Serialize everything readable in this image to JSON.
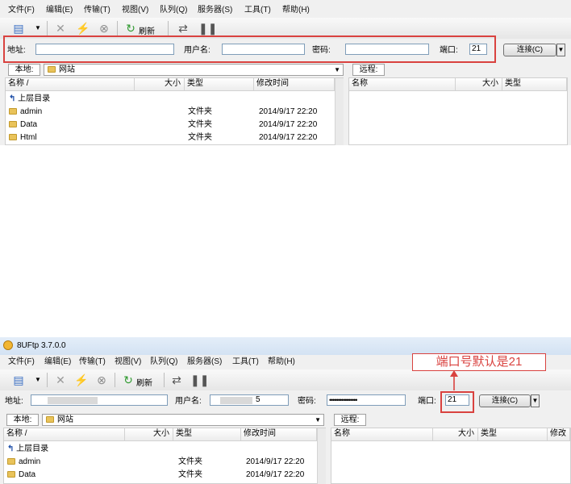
{
  "top": {
    "menu": [
      "文件(F)",
      "编辑(E)",
      "传输(T)",
      "视图(V)",
      "队列(Q)",
      "服务器(S)",
      "工具(T)",
      "帮助(H)"
    ],
    "toolbar": {
      "refresh_label": "刷新"
    },
    "quickconnect": {
      "host_label": "地址:",
      "host_value": "",
      "user_label": "用户名:",
      "user_value": "",
      "password_label": "密码:",
      "password_value": "",
      "port_label": "端口:",
      "port_value": "21",
      "connect_label": "连接(C)"
    },
    "local": {
      "tab_label": "本地:",
      "path": "网站",
      "columns": [
        "名称 /",
        "大小",
        "类型",
        "修改时间"
      ],
      "parent_label": "上层目录",
      "rows": [
        {
          "name": "admin",
          "type": "文件夹",
          "modified": "2014/9/17 22:20"
        },
        {
          "name": "Data",
          "type": "文件夹",
          "modified": "2014/9/17 22:20"
        },
        {
          "name": "Html",
          "type": "文件夹",
          "modified": "2014/9/17 22:20"
        }
      ]
    },
    "remote": {
      "tab_label": "远程:",
      "columns": [
        "名称",
        "大小",
        "类型"
      ]
    }
  },
  "bottom": {
    "app_title": "8UFtp 3.7.0.0",
    "menu": [
      "文件(F)",
      "编辑(E)",
      "传输(T)",
      "视图(V)",
      "队列(Q)",
      "服务器(S)",
      "工具(T)",
      "帮助(H)"
    ],
    "toolbar": {
      "refresh_label": "刷新"
    },
    "annotation": "端口号默认是21",
    "quickconnect": {
      "host_label": "地址:",
      "user_label": "用户名:",
      "user_value": "5",
      "password_label": "密码:",
      "password_value": "••••••••••••••••",
      "port_label": "端口:",
      "port_value": "21",
      "connect_label": "连接(C)"
    },
    "local": {
      "tab_label": "本地:",
      "path": "网站",
      "columns": [
        "名称 /",
        "大小",
        "类型",
        "修改时间"
      ],
      "parent_label": "上层目录",
      "rows": [
        {
          "name": "admin",
          "type": "文件夹",
          "modified": "2014/9/17 22:20"
        },
        {
          "name": "Data",
          "type": "文件夹",
          "modified": "2014/9/17 22:20"
        }
      ]
    },
    "remote": {
      "tab_label": "远程:",
      "columns": [
        "名称",
        "大小",
        "类型",
        "修改"
      ]
    }
  },
  "colors": {
    "highlight": "#d9423f",
    "folder": "#e9c35a"
  }
}
